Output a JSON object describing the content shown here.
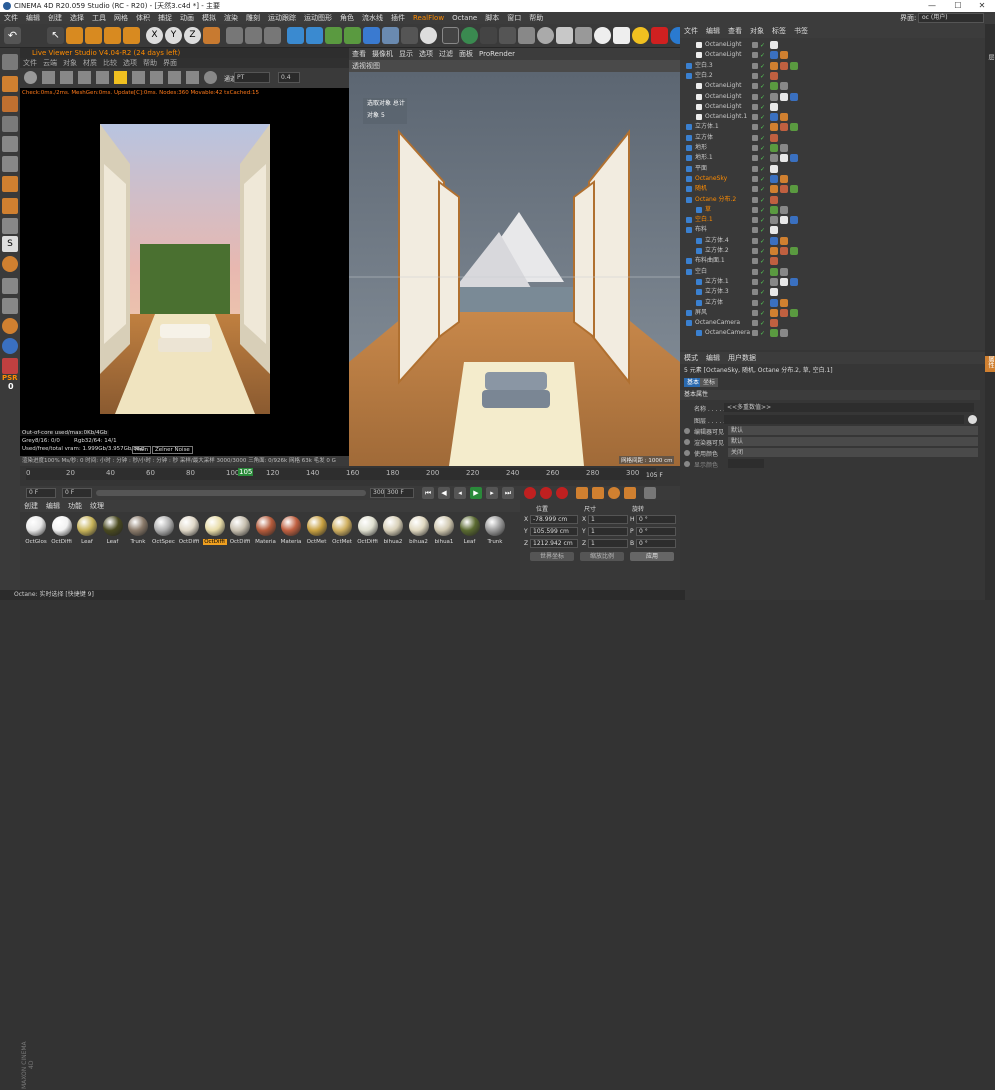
{
  "window": {
    "title": "CINEMA 4D R20.059 Studio (RC - R20) - [天然3.c4d *] - 主要",
    "min": "—",
    "max": "☐",
    "close": "✕"
  },
  "menu": [
    "文件",
    "编辑",
    "创建",
    "选择",
    "工具",
    "网格",
    "体积",
    "捕捉",
    "动画",
    "模拟",
    "渲染",
    "雕刻",
    "运动跟踪",
    "运动图形",
    "角色",
    "流水线",
    "插件",
    "RealFlow",
    "Octane",
    "脚本",
    "窗口",
    "帮助"
  ],
  "layout": {
    "label": "界面:",
    "value": "oc (用户)"
  },
  "liveviewer": {
    "title": "Live Viewer Studio V4.04-R2 (24 days left)",
    "menu": [
      "文件",
      "云端",
      "对象",
      "材质",
      "比较",
      "选项",
      "帮助",
      "界面"
    ],
    "channel_label": "通道",
    "channel": "PT",
    "value": "0.4",
    "stats": "Check:0ms./2ms. MeshGen:0ms. Update[C]:0ms. Nodes:360 Movable:42 txCached:15",
    "info": {
      "line1": "Out-of-core used/max:0Kb/4Gb",
      "line2a": "Grey8/16: 0/0",
      "line2b": "Rgb32/64: 14/1",
      "line3": "Used/free/total vram: 1.999Gb/3.957Gb/8Gb",
      "mode": "Main",
      "note": "Zelner Noise"
    },
    "bar": "渲染进度100%  Ms/秒: 0  时间: 小时 : 分钟 : 秒/小时 : 分钟 : 秒  采样/最大采样 3000/3000  三角面: 0/926k  网格 63k  毛发 0  G"
  },
  "viewport": {
    "menu": [
      "查看",
      "摄像机",
      "显示",
      "选项",
      "过滤",
      "面板",
      "ProRender"
    ],
    "label": "透视视图",
    "sel_title": "选取对象 总计",
    "sel_obj": "对象",
    "sel_count": "5",
    "grid": "网格间距 : 1000 cm"
  },
  "timeline": {
    "ticks": [
      "0",
      "20",
      "40",
      "60",
      "80",
      "100",
      "105",
      "120",
      "140",
      "160",
      "180",
      "200",
      "220",
      "240",
      "260",
      "280",
      "300"
    ],
    "current": "105 F",
    "end": "105 F"
  },
  "frames": {
    "start": "0 F",
    "left": "0 F",
    "right": "300 F",
    "end": "300 F"
  },
  "materials": {
    "menu": [
      "创建",
      "编辑",
      "功能",
      "纹理"
    ],
    "items": [
      {
        "name": "OctGlos",
        "color": "#e8e8e8"
      },
      {
        "name": "OctDiffi",
        "color": "#f2f2f2"
      },
      {
        "name": "Leaf",
        "color": "#c8b45a"
      },
      {
        "name": "Leaf",
        "color": "#4a4a20"
      },
      {
        "name": "Trunk",
        "color": "#8a7a6a"
      },
      {
        "name": "OctSpec",
        "color": "#b0b0b0"
      },
      {
        "name": "OctDiffi",
        "color": "#e0d8c8"
      },
      {
        "name": "OctDiffi",
        "color": "#e8dca8"
      },
      {
        "name": "OctDiffi",
        "color": "#c8c0b0"
      },
      {
        "name": "Materia",
        "color": "#b45a3a"
      },
      {
        "name": "Materia",
        "color": "#c06040"
      },
      {
        "name": "OctMet",
        "color": "#c8a040"
      },
      {
        "name": "OctMet",
        "color": "#d0b060"
      },
      {
        "name": "OctDiffi",
        "color": "#e0e0d0"
      },
      {
        "name": "bihua2",
        "color": "#d8d0b8"
      },
      {
        "name": "bihua2",
        "color": "#e0d8c0"
      },
      {
        "name": "bihua1",
        "color": "#d0c8b0"
      },
      {
        "name": "Leaf",
        "color": "#5a6a30"
      },
      {
        "name": "Trunk",
        "color": "#9a9a9a"
      }
    ],
    "selected": "OctDiffi"
  },
  "coords": {
    "h_pos": "位置",
    "h_size": "尺寸",
    "h_rot": "旋转",
    "rows": [
      {
        "axis": "X",
        "pos": "-78.999 cm",
        "s": "X",
        "size": "1",
        "r": "H",
        "rot": "0 °"
      },
      {
        "axis": "Y",
        "pos": "105.599 cm",
        "s": "Y",
        "size": "1",
        "r": "P",
        "rot": "0 °"
      },
      {
        "axis": "Z",
        "pos": "1212.942 cm",
        "s": "Z",
        "size": "1",
        "r": "B",
        "rot": "0 °"
      }
    ],
    "mode1": "世界坐标",
    "mode2": "缩放比例",
    "apply": "应用"
  },
  "objects": {
    "menu": [
      "文件",
      "编辑",
      "查看",
      "对象",
      "标签",
      "书签"
    ],
    "rows": [
      {
        "name": "OctaneLight",
        "indent": 1,
        "color": "#c8c8c8"
      },
      {
        "name": "OctaneLight",
        "indent": 1,
        "color": "#c8c8c8"
      },
      {
        "name": "空白.3",
        "indent": 0,
        "color": "#c8c8c8"
      },
      {
        "name": "空白.2",
        "indent": 0,
        "color": "#c8c8c8"
      },
      {
        "name": "OctaneLight",
        "indent": 1,
        "color": "#c8c8c8"
      },
      {
        "name": "OctaneLight",
        "indent": 1,
        "color": "#c8c8c8"
      },
      {
        "name": "OctaneLight",
        "indent": 1,
        "color": "#c8c8c8"
      },
      {
        "name": "OctaneLight.1",
        "indent": 1,
        "color": "#c8c8c8"
      },
      {
        "name": "立方体.1",
        "indent": 0,
        "color": "#c8c8c8"
      },
      {
        "name": "立方体",
        "indent": 0,
        "color": "#c8c8c8"
      },
      {
        "name": "地形",
        "indent": 0,
        "color": "#c8c8c8"
      },
      {
        "name": "地形.1",
        "indent": 0,
        "color": "#c8c8c8"
      },
      {
        "name": "平面",
        "indent": 0,
        "color": "#c8c8c8"
      },
      {
        "name": "OctaneSky",
        "indent": 0,
        "color": "#ff8c00"
      },
      {
        "name": "随机",
        "indent": 0,
        "color": "#ff8c00"
      },
      {
        "name": "Octane 分布.2",
        "indent": 0,
        "color": "#ff8c00"
      },
      {
        "name": "草",
        "indent": 1,
        "color": "#ff8c00"
      },
      {
        "name": "空白.1",
        "indent": 0,
        "color": "#ff8c00"
      },
      {
        "name": "布料",
        "indent": 0,
        "color": "#c8c8c8"
      },
      {
        "name": "立方体.4",
        "indent": 1,
        "color": "#c8c8c8"
      },
      {
        "name": "立方体.2",
        "indent": 1,
        "color": "#c8c8c8"
      },
      {
        "name": "布料曲面.1",
        "indent": 0,
        "color": "#c8c8c8"
      },
      {
        "name": "空白",
        "indent": 0,
        "color": "#c8c8c8"
      },
      {
        "name": "立方体.1",
        "indent": 1,
        "color": "#c8c8c8"
      },
      {
        "name": "立方体.3",
        "indent": 1,
        "color": "#c8c8c8"
      },
      {
        "name": "立方体",
        "indent": 1,
        "color": "#c8c8c8"
      },
      {
        "name": "屏风",
        "indent": 0,
        "color": "#c8c8c8"
      },
      {
        "name": "OctaneCamera",
        "indent": 0,
        "color": "#c8c8c8"
      },
      {
        "name": "OctaneCamera",
        "indent": 1,
        "color": "#c8c8c8"
      }
    ]
  },
  "attributes": {
    "menu": [
      "模式",
      "编辑",
      "用户数据"
    ],
    "summary": "5 元素 [OctaneSky, 随机, Octane 分布.2, 草, 空白.1]",
    "tab_basic": "基本",
    "tab_coord": "坐标",
    "section": "基本属性",
    "name_label": "名称 . . . . . . . . . .",
    "name_value": "<<多重数值>>",
    "layer_label": "图层 . . . . . . . . . .",
    "vis_editor_label": "编辑器可见",
    "vis_editor_value": "默认",
    "vis_render_label": "渲染器可见",
    "vis_render_value": "默认",
    "color_label": "使用颜色",
    "color_value": "关闭",
    "display_label": "显示颜色"
  },
  "sidetabs": [
    "属性",
    "层"
  ],
  "maxon": "MAXON CINEMA 4D",
  "status": "Octane:     实时选择 [快捷键 9]",
  "psr": {
    "label": "PSR",
    "value": "0"
  }
}
